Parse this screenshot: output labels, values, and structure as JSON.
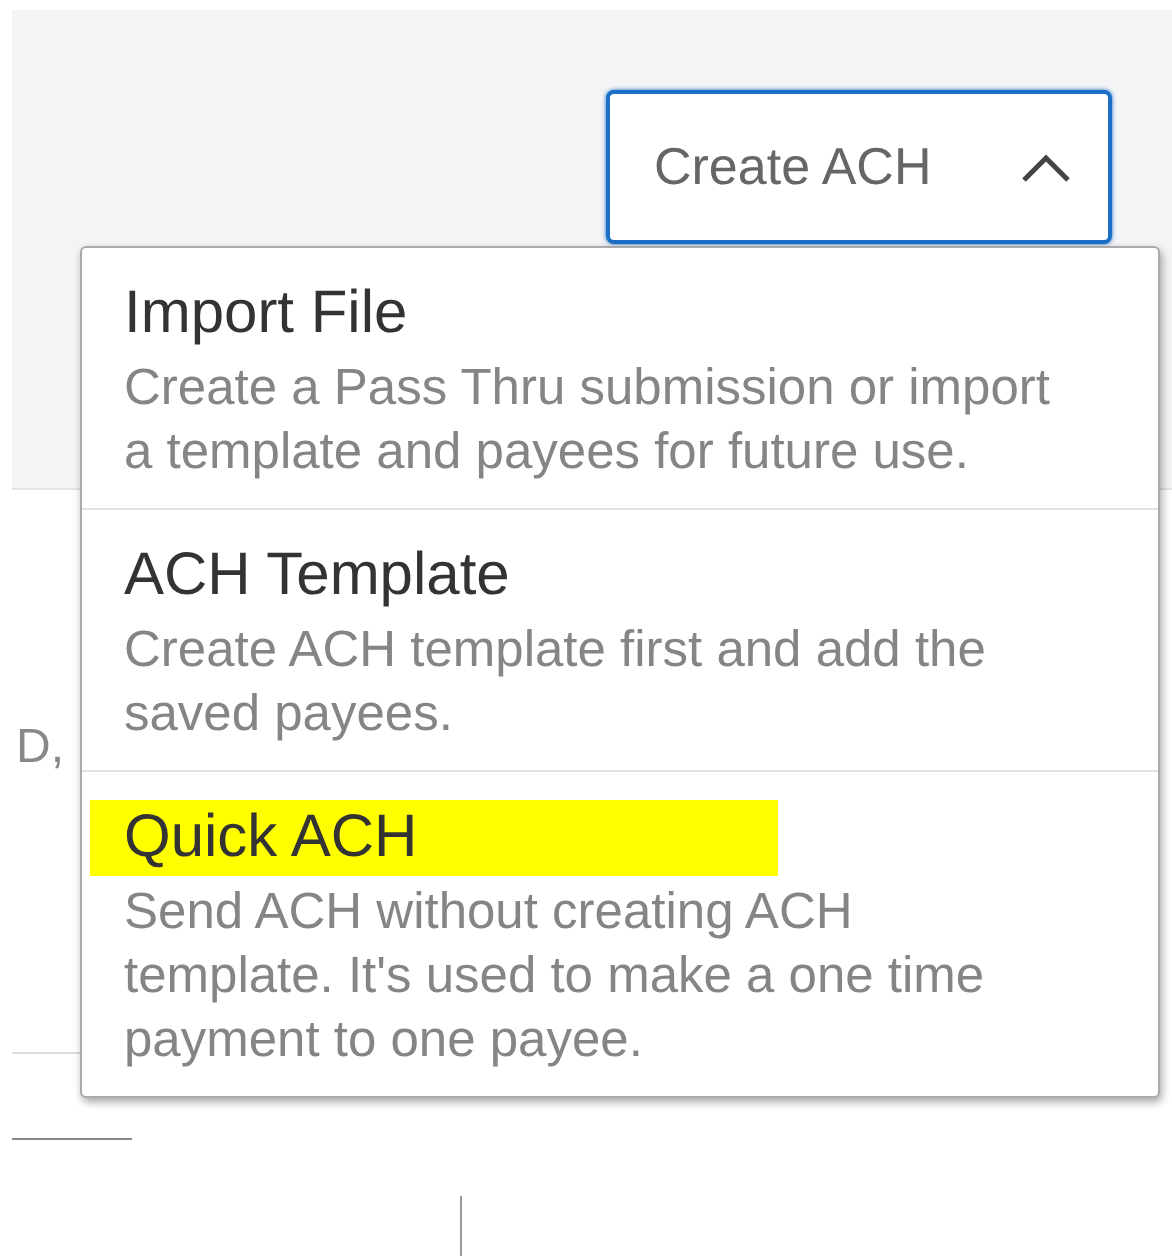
{
  "dropdown": {
    "label": "Create ACH",
    "expanded": true
  },
  "background_text": "D,",
  "menu": [
    {
      "title": "Import File",
      "description": "Create a Pass Thru submission or import a template and payees for future use.",
      "highlighted": false
    },
    {
      "title": "ACH Template",
      "description": "Create ACH template first and add the saved payees.",
      "highlighted": false
    },
    {
      "title": "Quick ACH",
      "description": "Send ACH without creating ACH template. It's used to make a one time payment to one payee.",
      "highlighted": true
    }
  ]
}
